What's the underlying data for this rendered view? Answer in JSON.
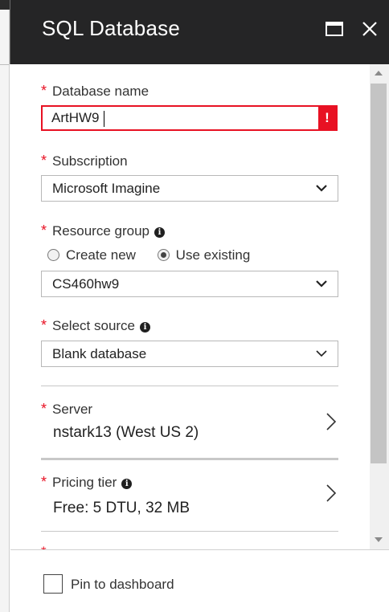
{
  "window": {
    "title": "SQL Database",
    "maximize_icon": "maximize-icon",
    "close_icon": "close-icon",
    "header_color": "#252526"
  },
  "form": {
    "required_mark": "*",
    "database_name": {
      "label": "Database name",
      "value": "ArtHW9",
      "error_badge": "!",
      "error_color": "#e81123"
    },
    "subscription": {
      "label": "Subscription",
      "value": "Microsoft Imagine"
    },
    "resource_group": {
      "label": "Resource group",
      "info_glyph": "i",
      "options": [
        {
          "label": "Create new",
          "selected": false
        },
        {
          "label": "Use existing",
          "selected": true
        }
      ],
      "value": "CS460hw9"
    },
    "select_source": {
      "label": "Select source",
      "info_glyph": "i",
      "value": "Blank database"
    },
    "server": {
      "label": "Server",
      "value": "nstark13 (West US 2)"
    },
    "pricing_tier": {
      "label": "Pricing tier",
      "info_glyph": "i",
      "value": "Free: 5 DTU, 32 MB"
    }
  },
  "footer": {
    "pin_label": "Pin to dashboard",
    "pin_checked": false
  }
}
